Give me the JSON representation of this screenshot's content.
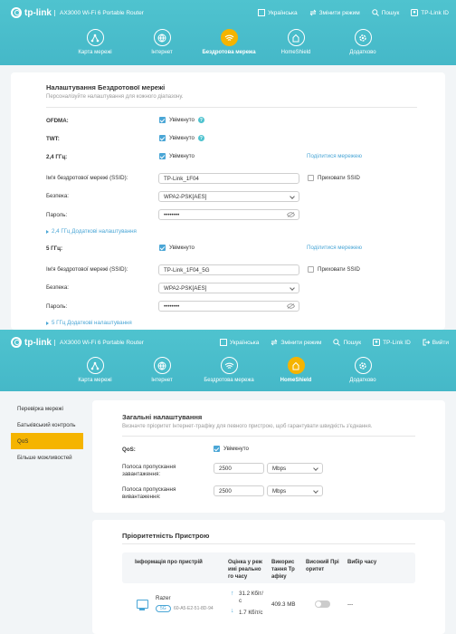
{
  "brand": {
    "logo": "tp-link",
    "model": "AX3000 Wi-Fi 6 Portable Router"
  },
  "top_links": [
    {
      "label": "Українська",
      "icon": "flag-icon"
    },
    {
      "label": "Змінити режим",
      "icon": "switch-mode-icon"
    },
    {
      "label": "Пошук",
      "icon": "search-icon"
    },
    {
      "label": "TP-Link ID",
      "icon": "user-icon"
    },
    {
      "label": "Вийти",
      "icon": "logout-icon"
    }
  ],
  "nav": [
    {
      "label": "Карта мережі",
      "icon": "network-map-icon"
    },
    {
      "label": "Інтернет",
      "icon": "globe-icon"
    },
    {
      "label": "Бездротова мережа",
      "icon": "wifi-icon"
    },
    {
      "label": "HomeShield",
      "icon": "homeshield-icon"
    },
    {
      "label": "Додатково",
      "icon": "gear-icon"
    }
  ],
  "nav_active_1": "Бездротова мережа",
  "nav_active_2": "HomeShield",
  "wireless": {
    "title": "Налаштування Бездротової мережі",
    "subtitle": "Персоналізуйте налаштування для кожного діапазону.",
    "ofdma_label": "OFDMA:",
    "ofdma_value": "Увімкнуто",
    "twt_label": "TWT:",
    "twt_value": "Увімкнуто",
    "band24_label": "2,4 ГГц:",
    "band24_value": "Увімкнуто",
    "share_network": "Поділитися мережею",
    "ssid_label": "Ім'я бездротової мережі (SSID):",
    "ssid24": "TP-Link_1F04",
    "hide_ssid": "Приховати SSID",
    "security_label": "Безпека:",
    "security24": "WPA2-PSK[AES]",
    "password_label": "Пароль:",
    "password24": "••••••••",
    "adv24": "2,4 ГГц Додаткові налаштування",
    "band5_label": "5 ГГц:",
    "band5_value": "Увімкнуто",
    "ssid5": "TP-Link_1F04_5G",
    "security5": "WPA2-PSK[AES]",
    "password5": "••••••••",
    "adv5": "5 ГГц Додаткові налаштування"
  },
  "sidebar": [
    {
      "label": "Перевірка мережі"
    },
    {
      "label": "Батьківський контроль"
    },
    {
      "label": "QoS"
    },
    {
      "label": "Більше можливостей"
    }
  ],
  "sidebar_active": "QoS",
  "qos": {
    "title": "Загальні налаштування",
    "subtitle": "Визначте пріоритет Інтернет-трафіку для певного пристрою, щоб гарантувати швидкість з'єднання.",
    "qos_label": "QoS:",
    "qos_value": "Увімкнуто",
    "down_label_1": "Полоса пропускання",
    "down_label_2": "завантаження:",
    "down_value": "2500",
    "down_unit": "Mbps",
    "up_label_1": "Полоса пропускання",
    "up_label_2": "вивантаження:",
    "up_value": "2500",
    "up_unit": "Mbps"
  },
  "priority": {
    "title": "Пріоритетність Пристрою",
    "headers": {
      "info": "Інформація про пристрій",
      "realtime": [
        "Оцінка у реж",
        "имі реально",
        "го часу"
      ],
      "usage": [
        "Викорис",
        "тання Тр",
        "афіку"
      ],
      "high": [
        "Високий Прі",
        "оритет"
      ],
      "time": "Вибір часу"
    },
    "rows": [
      {
        "name": "Razer",
        "band": "5G",
        "mac": "60-A5-E2-51-8D-94",
        "up_speed": [
          "31.2 Кбіт/",
          "с"
        ],
        "down_speed": [
          "1.7 Кбіт/с"
        ],
        "usage": "409.3 MB",
        "high_priority": false,
        "time": "---"
      }
    ]
  }
}
